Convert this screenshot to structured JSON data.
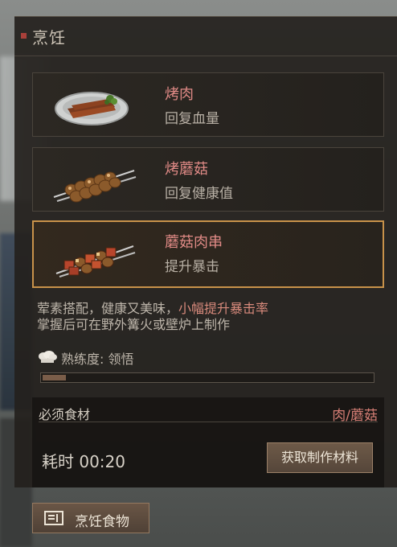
{
  "header": {
    "title": "烹饪"
  },
  "recipes": [
    {
      "name": "烤肉",
      "desc": "回复血量",
      "thumb_icon": "grilled-meat-plate-icon"
    },
    {
      "name": "烤蘑菇",
      "desc": "回复健康值",
      "thumb_icon": "mushroom-skewer-icon"
    },
    {
      "name": "蘑菇肉串",
      "desc": "提升暴击",
      "thumb_icon": "meat-mushroom-skewer-icon",
      "selected": true
    }
  ],
  "detail": {
    "line1_prefix": "荤素搭配，健康又美味，",
    "line1_highlight": "小幅提升暴击率",
    "line2": "掌握后可在野外篝火或壁炉上制作"
  },
  "proficiency": {
    "label": "熟练度: 领悟",
    "icon": "chef-hat-icon",
    "level": 0.07
  },
  "requirements": {
    "label": "必须食材",
    "value": "肉/蘑菇",
    "time": "耗时 00:20",
    "get_button": "获取制作材料"
  },
  "cook_button": {
    "label": "烹饪食物",
    "icon": "recipe-book-icon"
  },
  "colors": {
    "accent": "#c8924a",
    "item_name": "#e08a86",
    "highlight": "#d88a7c"
  }
}
